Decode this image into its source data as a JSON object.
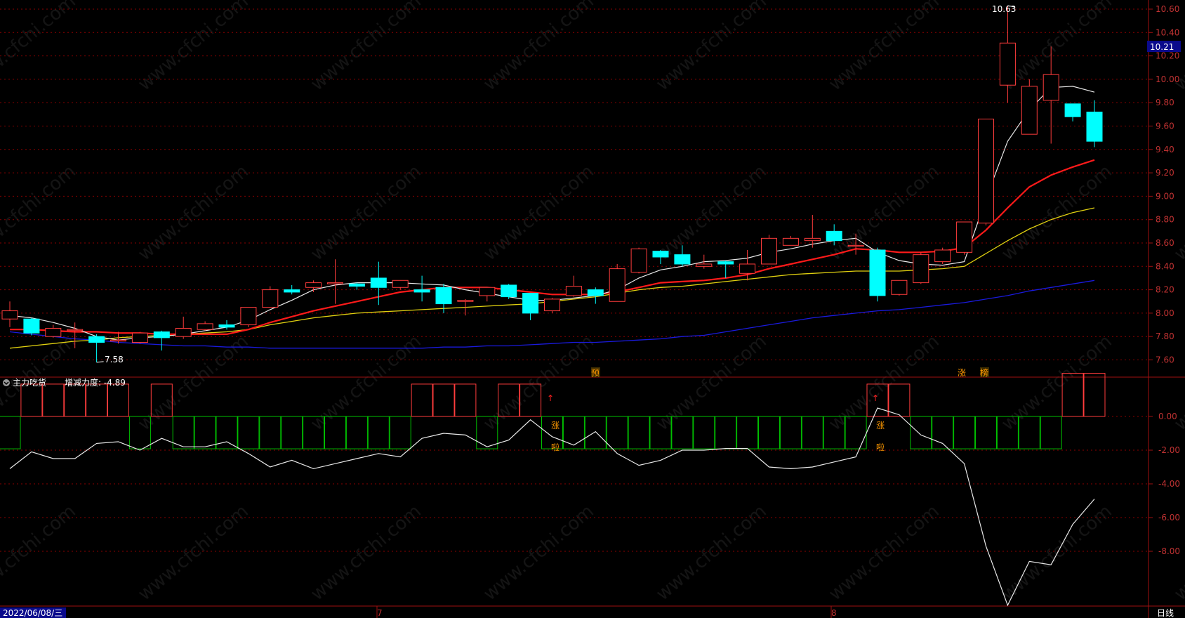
{
  "colors": {
    "up": "#ff3c3c",
    "down": "#00ffff",
    "ma5": "#e8e8e8",
    "ma10": "#ff1a1a",
    "ma20": "#e0d010",
    "ma60": "#1a1adc",
    "grid": "#8b0000",
    "green": "#00c000"
  },
  "price_axis": {
    "ticks": [
      "10.60",
      "10.40",
      "10.20",
      "10.00",
      "9.80",
      "9.60",
      "9.40",
      "9.20",
      "9.00",
      "8.80",
      "8.60",
      "8.40",
      "8.20",
      "8.00",
      "7.80",
      "7.60"
    ],
    "current": "10.21"
  },
  "annotations": {
    "high": "10.63",
    "low": "7.58",
    "top_marks": [
      "预",
      "涨",
      "榜"
    ],
    "sub_marks": [
      "涨",
      "啦"
    ]
  },
  "indicator": {
    "name": "主力吃货",
    "label": "增减力度: -4.89",
    "ticks": [
      "0.00",
      "-2.00",
      "-4.00",
      "-6.00",
      "-8.00"
    ]
  },
  "footer": {
    "date": "2022/06/08/三",
    "months": [
      "7",
      "8"
    ],
    "period": "日线"
  },
  "watermark": "www.cfchi.com",
  "chart_data": {
    "type": "candlestick",
    "ylim": [
      7.5,
      10.65
    ],
    "candles": [
      [
        7.95,
        8.02,
        7.88,
        8.1
      ],
      [
        7.95,
        7.83,
        7.81,
        7.96
      ],
      [
        7.8,
        7.87,
        7.79,
        7.9
      ],
      [
        7.86,
        7.86,
        7.7,
        7.92
      ],
      [
        7.8,
        7.75,
        7.58,
        7.82
      ],
      [
        7.77,
        7.77,
        7.74,
        7.84
      ],
      [
        7.75,
        7.83,
        7.74,
        7.84
      ],
      [
        7.84,
        7.79,
        7.68,
        7.85
      ],
      [
        7.8,
        7.87,
        7.78,
        7.97
      ],
      [
        7.86,
        7.91,
        7.85,
        7.93
      ],
      [
        7.9,
        7.88,
        7.86,
        7.94
      ],
      [
        7.9,
        8.05,
        7.88,
        8.05
      ],
      [
        8.05,
        8.2,
        8.05,
        8.23
      ],
      [
        8.2,
        8.18,
        8.16,
        8.24
      ],
      [
        8.22,
        8.26,
        8.18,
        8.28
      ],
      [
        8.26,
        8.26,
        8.08,
        8.46
      ],
      [
        8.25,
        8.23,
        8.2,
        8.26
      ],
      [
        8.3,
        8.22,
        8.07,
        8.44
      ],
      [
        8.22,
        8.28,
        8.2,
        8.28
      ],
      [
        8.2,
        8.18,
        8.1,
        8.32
      ],
      [
        8.22,
        8.08,
        8.0,
        8.25
      ],
      [
        8.1,
        8.11,
        7.98,
        8.12
      ],
      [
        8.15,
        8.22,
        8.1,
        8.22
      ],
      [
        8.24,
        8.14,
        8.12,
        8.25
      ],
      [
        8.17,
        8.0,
        7.94,
        8.17
      ],
      [
        8.02,
        8.12,
        8.0,
        8.13
      ],
      [
        8.15,
        8.23,
        8.14,
        8.32
      ],
      [
        8.2,
        8.15,
        8.08,
        8.22
      ],
      [
        8.1,
        8.38,
        8.1,
        8.42
      ],
      [
        8.35,
        8.55,
        8.34,
        8.56
      ],
      [
        8.53,
        8.48,
        8.42,
        8.54
      ],
      [
        8.5,
        8.42,
        8.4,
        8.58
      ],
      [
        8.4,
        8.42,
        8.38,
        8.5
      ],
      [
        8.44,
        8.42,
        8.3,
        8.45
      ],
      [
        8.34,
        8.42,
        8.28,
        8.54
      ],
      [
        8.42,
        8.64,
        8.42,
        8.67
      ],
      [
        8.58,
        8.64,
        8.58,
        8.66
      ],
      [
        8.62,
        8.64,
        8.56,
        8.84
      ],
      [
        8.7,
        8.62,
        8.58,
        8.76
      ],
      [
        8.58,
        8.58,
        8.5,
        8.68
      ],
      [
        8.54,
        8.15,
        8.1,
        8.56
      ],
      [
        8.16,
        8.28,
        8.15,
        8.28
      ],
      [
        8.26,
        8.5,
        8.25,
        8.52
      ],
      [
        8.44,
        8.54,
        8.42,
        8.56
      ],
      [
        8.52,
        8.78,
        8.5,
        8.78
      ],
      [
        8.77,
        9.66,
        8.75,
        9.66
      ],
      [
        9.95,
        10.31,
        9.8,
        10.63
      ],
      [
        9.53,
        9.94,
        9.53,
        10.0
      ],
      [
        9.82,
        10.04,
        9.45,
        10.28
      ],
      [
        9.79,
        9.68,
        9.64,
        9.79
      ],
      [
        9.72,
        9.47,
        9.42,
        9.82
      ]
    ],
    "ma5": [
      7.98,
      7.96,
      7.92,
      7.87,
      7.8,
      7.77,
      7.79,
      7.8,
      7.82,
      7.85,
      7.88,
      7.94,
      8.03,
      8.11,
      8.2,
      8.24,
      8.26,
      8.26,
      8.26,
      8.25,
      8.24,
      8.2,
      8.17,
      8.14,
      8.11,
      8.11,
      8.13,
      8.15,
      8.2,
      8.3,
      8.37,
      8.4,
      8.44,
      8.45,
      8.47,
      8.52,
      8.55,
      8.59,
      8.62,
      8.64,
      8.52,
      8.45,
      8.42,
      8.41,
      8.44,
      8.98,
      9.47,
      9.74,
      9.93,
      9.94,
      9.89
    ],
    "ma10": [
      7.86,
      7.86,
      7.85,
      7.84,
      7.84,
      7.83,
      7.83,
      7.82,
      7.82,
      7.82,
      7.82,
      7.86,
      7.92,
      7.97,
      8.02,
      8.06,
      8.1,
      8.14,
      8.18,
      8.2,
      8.22,
      8.22,
      8.22,
      8.2,
      8.18,
      8.16,
      8.16,
      8.16,
      8.18,
      8.22,
      8.26,
      8.27,
      8.28,
      8.3,
      8.33,
      8.38,
      8.42,
      8.46,
      8.5,
      8.55,
      8.54,
      8.52,
      8.52,
      8.53,
      8.56,
      8.71,
      8.9,
      9.08,
      9.18,
      9.25,
      9.31
    ],
    "ma20": [
      7.7,
      7.72,
      7.74,
      7.76,
      7.77,
      7.79,
      7.8,
      7.81,
      7.82,
      7.83,
      7.84,
      7.86,
      7.9,
      7.93,
      7.96,
      7.98,
      8.0,
      8.01,
      8.02,
      8.03,
      8.04,
      8.05,
      8.06,
      8.07,
      8.08,
      8.1,
      8.12,
      8.14,
      8.17,
      8.2,
      8.22,
      8.23,
      8.25,
      8.27,
      8.29,
      8.31,
      8.33,
      8.34,
      8.35,
      8.36,
      8.36,
      8.36,
      8.37,
      8.38,
      8.4,
      8.51,
      8.62,
      8.72,
      8.8,
      8.86,
      8.9
    ],
    "ma60": [
      7.84,
      7.82,
      7.8,
      7.78,
      7.77,
      7.75,
      7.74,
      7.73,
      7.72,
      7.72,
      7.71,
      7.71,
      7.7,
      7.7,
      7.7,
      7.7,
      7.7,
      7.7,
      7.7,
      7.7,
      7.71,
      7.71,
      7.72,
      7.72,
      7.73,
      7.74,
      7.75,
      7.75,
      7.76,
      7.77,
      7.78,
      7.8,
      7.81,
      7.84,
      7.87,
      7.9,
      7.93,
      7.96,
      7.98,
      8.0,
      8.02,
      8.03,
      8.05,
      8.07,
      8.09,
      8.12,
      8.15,
      8.19,
      8.22,
      8.25,
      8.28
    ],
    "indicator_line": [
      -3.1,
      -2.1,
      -2.5,
      -2.5,
      -1.6,
      -1.5,
      -2.0,
      -1.3,
      -1.8,
      -1.8,
      -1.5,
      -2.2,
      -3.0,
      -2.6,
      -3.1,
      -2.8,
      -2.5,
      -2.2,
      -2.4,
      -1.3,
      -1.0,
      -1.1,
      -1.8,
      -1.4,
      -0.2,
      -1.2,
      -1.7,
      -0.9,
      -2.2,
      -2.9,
      -2.6,
      -2.0,
      -2.0,
      -1.9,
      -1.9,
      -3.0,
      -3.1,
      -3.0,
      -2.7,
      -2.4,
      0.5,
      0.1,
      -1.1,
      -1.6,
      -2.8,
      -7.7,
      -11.2,
      -8.6,
      -8.8,
      -6.4,
      -4.9
    ],
    "indicator_bars": [
      -0.6,
      0.6,
      0.6,
      0.6,
      0.6,
      0.6,
      -0.6,
      0.6,
      -0.6,
      -0.6,
      -0.6,
      -0.6,
      -0.6,
      -0.6,
      -0.6,
      -0.6,
      -0.6,
      -0.6,
      -0.6,
      0.6,
      0.6,
      0.6,
      -0.6,
      0.6,
      0.6,
      -0.6,
      -0.6,
      -0.6,
      -0.6,
      -0.6,
      -0.6,
      -0.6,
      -0.6,
      -0.6,
      -0.6,
      -0.6,
      -0.6,
      -0.6,
      -0.6,
      -0.6,
      0.6,
      0.6,
      -0.6,
      -0.6,
      -0.6,
      -0.6,
      -0.6,
      -0.6,
      -0.6,
      0.8,
      0.8
    ],
    "indicator_ylim": [
      -11.2,
      1.2
    ]
  }
}
